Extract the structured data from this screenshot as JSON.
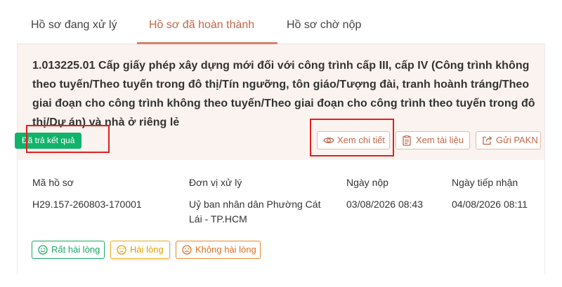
{
  "tabs": [
    {
      "label": "Hồ sơ đang xử lý"
    },
    {
      "label": "Hồ sơ đã hoàn thành"
    },
    {
      "label": "Hồ sơ chờ nộp"
    }
  ],
  "active_tab": "Hồ sơ đã hoàn thành",
  "record": {
    "title": "1.013225.01 Cấp giấy phép xây dựng mới đối với công trình cấp III, cấp IV (Công trình không theo tuyến/Theo tuyến trong đô thị/Tín ngưỡng, tôn giáo/Tượng đài, tranh hoành tráng/Theo giai đoạn cho công trình không theo tuyến/Theo giai đoạn cho công trình theo tuyến trong đô thị/Dự án) và nhà ở riêng lẻ",
    "status": "Đã trả kết quả",
    "actions": {
      "view_detail": "Xem chi tiết",
      "view_documents": "Xem tài liệu",
      "send_feedback": "Gửi PAKN"
    },
    "fields": {
      "code_label": "Mã hồ sơ",
      "code_value": "H29.157-260803-170001",
      "unit_label": "Đơn vị xử lý",
      "unit_value": "Uỷ ban nhân dân Phường Cát Lái - TP.HCM",
      "submit_label": "Ngày nộp",
      "submit_value": "03/08/2026 08:43",
      "receive_label": "Ngày tiếp nhận",
      "receive_value": "04/08/2026 08:11"
    },
    "feedback": {
      "very_satisfied": "Rất hài lòng",
      "satisfied": "Hài lòng",
      "unsatisfied": "Không hài lòng"
    }
  },
  "colors": {
    "accent": "#c2684a",
    "status_green": "#11b36b",
    "highlight_red": "#e02020",
    "header_bg": "#fbf3ef"
  },
  "icons": [
    "eye-icon",
    "document-icon",
    "share-icon",
    "smile-icon",
    "neutral-face-icon",
    "frown-icon"
  ]
}
